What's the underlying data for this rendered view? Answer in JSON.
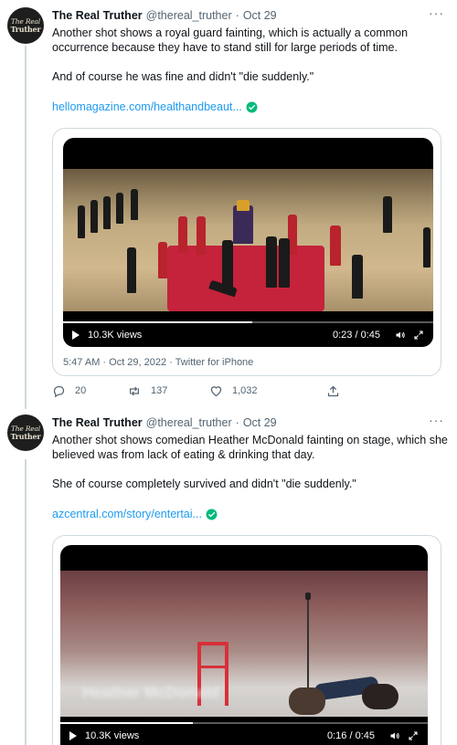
{
  "tweets": [
    {
      "author_name": "The Real Truther",
      "handle": "@thereal_truther",
      "separator": "·",
      "date": "Oct 29",
      "more": "···",
      "avatar_text": [
        "The Real",
        "Truther"
      ],
      "paragraphs": [
        "Another shot shows a royal guard fainting, which is actually a common occurrence because they have to stand still for large periods of time.",
        "And of course he was fine and didn't \"die suddenly.\""
      ],
      "link": "hellomagazine.com/healthandbeaut...",
      "video": {
        "views": "10.3K views",
        "timecode": "0:23 / 0:45",
        "progress": 0.51
      },
      "meta": "5:47 AM · Oct 29, 2022 · Twitter for iPhone",
      "replies": "20",
      "retweets": "137",
      "likes": "1,032"
    },
    {
      "author_name": "The Real Truther",
      "handle": "@thereal_truther",
      "separator": "·",
      "date": "Oct 29",
      "more": "···",
      "avatar_text": [
        "The Real",
        "Truther"
      ],
      "paragraphs": [
        "Another shot shows comedian Heather McDonald fainting on stage, which she believed was from lack of eating & drinking that day.",
        "She of course completely survived and didn't \"die suddenly.\""
      ],
      "link": "azcentral.com/story/entertai...",
      "video": {
        "views": "10.3K views",
        "timecode": "0:16 / 0:45",
        "progress": 0.36,
        "overlay_text": "Heather McDonald"
      }
    }
  ],
  "colors": {
    "link": "#1d9bf0",
    "verified": "#00ba7c",
    "secondary": "#536471",
    "border": "#cfd9de"
  }
}
